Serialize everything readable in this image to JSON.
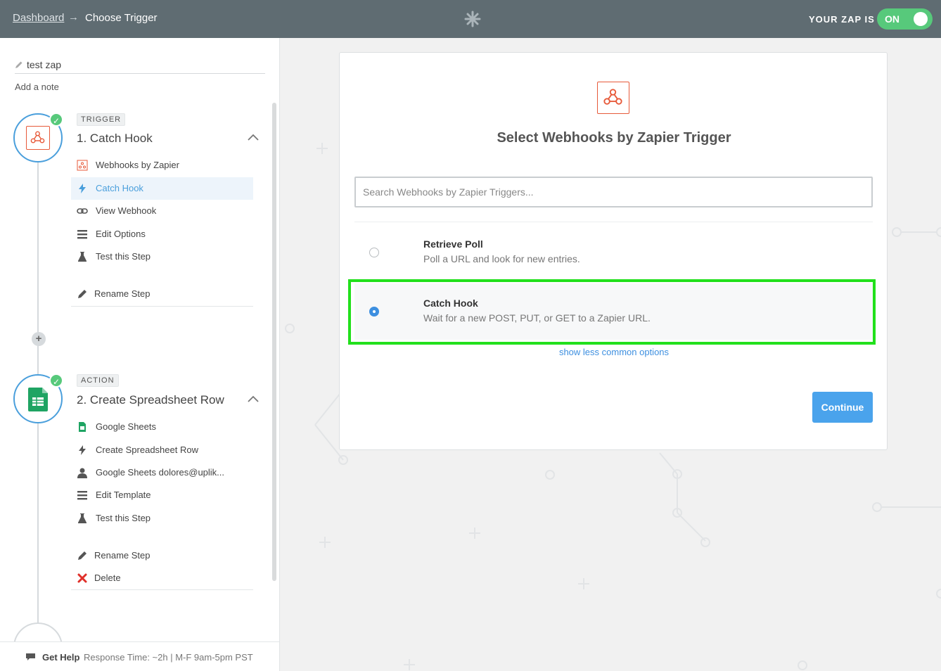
{
  "header": {
    "breadcrumb_dashboard": "Dashboard",
    "breadcrumb_arrow": "→",
    "breadcrumb_current": "Choose Trigger",
    "zap_status_label": "YOUR ZAP IS",
    "zap_status_value": "ON",
    "logo_icon": "zapier-asterisk-icon"
  },
  "sidebar": {
    "zap_name": "test zap",
    "add_note": "Add a note",
    "trigger": {
      "tag": "TRIGGER",
      "title": "1. Catch Hook",
      "items": [
        {
          "label": "Webhooks by Zapier",
          "icon": "webhook-icon"
        },
        {
          "label": "Catch Hook",
          "icon": "bolt-icon"
        },
        {
          "label": "View Webhook",
          "icon": "link-icon"
        },
        {
          "label": "Edit Options",
          "icon": "lines-icon"
        },
        {
          "label": "Test this Step",
          "icon": "flask-icon"
        },
        {
          "label": "Rename Step",
          "icon": "pencil-icon"
        }
      ]
    },
    "action": {
      "tag": "ACTION",
      "title": "2. Create Spreadsheet Row",
      "items": [
        {
          "label": "Google Sheets",
          "icon": "sheets-icon"
        },
        {
          "label": "Create Spreadsheet Row",
          "icon": "bolt-icon"
        },
        {
          "label": "Google Sheets dolores@uplik...",
          "icon": "user-icon"
        },
        {
          "label": "Edit Template",
          "icon": "lines-icon"
        },
        {
          "label": "Test this Step",
          "icon": "flask-icon"
        },
        {
          "label": "Rename Step",
          "icon": "pencil-icon"
        },
        {
          "label": "Delete",
          "icon": "delete-x-icon"
        }
      ]
    },
    "add_step_symbol": "+",
    "help": {
      "label": "Get Help",
      "info": "Response Time: ~2h | M-F 9am-5pm PST"
    }
  },
  "main": {
    "title": "Select Webhooks by Zapier Trigger",
    "search_placeholder": "Search Webhooks by Zapier Triggers...",
    "options": [
      {
        "title": "Retrieve Poll",
        "desc": "Poll a URL and look for new entries.",
        "selected": false
      },
      {
        "title": "Catch Hook",
        "desc": "Wait for a new POST, PUT, or GET to a Zapier URL.",
        "selected": true
      }
    ],
    "show_more": "show less common options",
    "continue_label": "Continue"
  },
  "colors": {
    "topbar": "#5f6c72",
    "accent_blue": "#4a9fdc",
    "toggle_green": "#57c97b",
    "webhook_orange": "#e75a3a",
    "highlight_green": "#22e01c"
  }
}
